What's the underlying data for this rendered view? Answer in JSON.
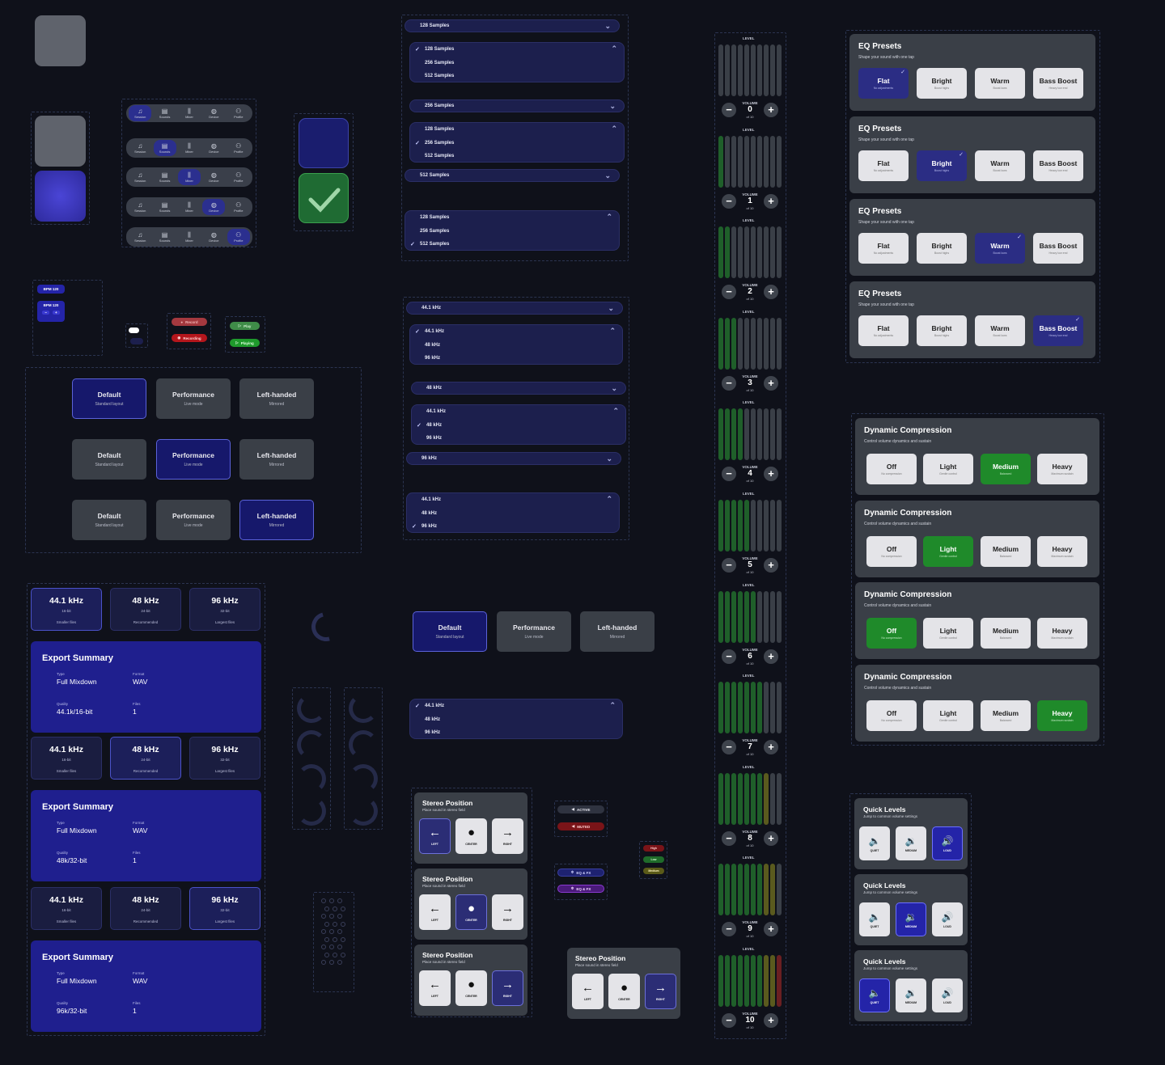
{
  "tabs": {
    "labels": [
      "Session",
      "Sounds",
      "Mixer",
      "Device",
      "Profile"
    ],
    "icons": [
      "♫",
      "▤",
      "⫼",
      "◍",
      "⚇"
    ],
    "active": [
      0,
      1,
      2,
      3,
      4
    ]
  },
  "bpm": {
    "label1": "BPM 120",
    "label2": "BPM 120",
    "minus": "−",
    "plus": "+"
  },
  "record": {
    "idle": "Record",
    "active": "Recording"
  },
  "play": {
    "idle": "Play",
    "active": "Playing"
  },
  "buffer": {
    "options": [
      "128 Samples",
      "256 Samples",
      "512 Samples"
    ]
  },
  "sample_rate": {
    "options": [
      "44.1 kHz",
      "48 kHz",
      "96 kHz"
    ]
  },
  "layouts": {
    "items": [
      {
        "name": "Default",
        "sub": "Standard layout"
      },
      {
        "name": "Performance",
        "sub": "Live mode"
      },
      {
        "name": "Left-handed",
        "sub": "Mirrored"
      }
    ]
  },
  "rates": {
    "items": [
      {
        "name": "44.1 kHz",
        "bit": "16-bit",
        "note": "Smaller files"
      },
      {
        "name": "48 kHz",
        "bit": "24-bit",
        "note": "Recommended"
      },
      {
        "name": "96 kHz",
        "bit": "32-bit",
        "note": "Largest files"
      }
    ]
  },
  "export": {
    "title": "Export Summary",
    "type_label": "Type",
    "type": "Full Mixdown",
    "format_label": "Format",
    "format": "WAV",
    "quality_label": "Quality",
    "files_label": "Files",
    "files": "1",
    "qualities": [
      "44.1k/16-bit",
      "48k/32-bit",
      "96k/32-bit"
    ]
  },
  "meters": {
    "level": "LEVEL",
    "volume": "VOLUME",
    "of": "of 10",
    "values": [
      0,
      1,
      2,
      3,
      4,
      5,
      6,
      7,
      8,
      9,
      10
    ],
    "minus": "−",
    "plus": "+"
  },
  "eq": {
    "title": "EQ Presets",
    "sub": "Shape your sound with one tap",
    "presets": [
      {
        "name": "Flat",
        "sub": "No adjustments"
      },
      {
        "name": "Bright",
        "sub": "Boost highs"
      },
      {
        "name": "Warm",
        "sub": "Boost lows"
      },
      {
        "name": "Bass Boost",
        "sub": "Heavy low end"
      }
    ],
    "check": "✓"
  },
  "compression": {
    "title": "Dynamic Compression",
    "sub": "Control volume dynamics and sustain",
    "options": [
      {
        "name": "Off",
        "sub": "No compression"
      },
      {
        "name": "Light",
        "sub": "Gentle control"
      },
      {
        "name": "Medium",
        "sub": "Balanced"
      },
      {
        "name": "Heavy",
        "sub": "Maximum sustain"
      }
    ]
  },
  "quick": {
    "title": "Quick Levels",
    "sub": "Jump to common volume settings",
    "options": [
      {
        "name": "QUIET",
        "icon": "🔈"
      },
      {
        "name": "MEDIUM",
        "icon": "🔉"
      },
      {
        "name": "LOUD",
        "icon": "🔊"
      }
    ]
  },
  "stereo": {
    "title": "Stereo Position",
    "sub": "Place sound in stereo field",
    "options": [
      {
        "name": "LEFT",
        "icon": "←"
      },
      {
        "name": "CENTER",
        "icon": "●"
      },
      {
        "name": "RIGHT",
        "icon": "→"
      }
    ]
  },
  "status": {
    "active": "ACTIVE",
    "muted": "MUTED",
    "eqfx": "EQ & FX"
  },
  "quality_tags": [
    "High",
    "Low",
    "Medium"
  ],
  "colors": {
    "accent": "#2b2d84",
    "green": "#1f8a2a",
    "bg": "#0f111a"
  }
}
